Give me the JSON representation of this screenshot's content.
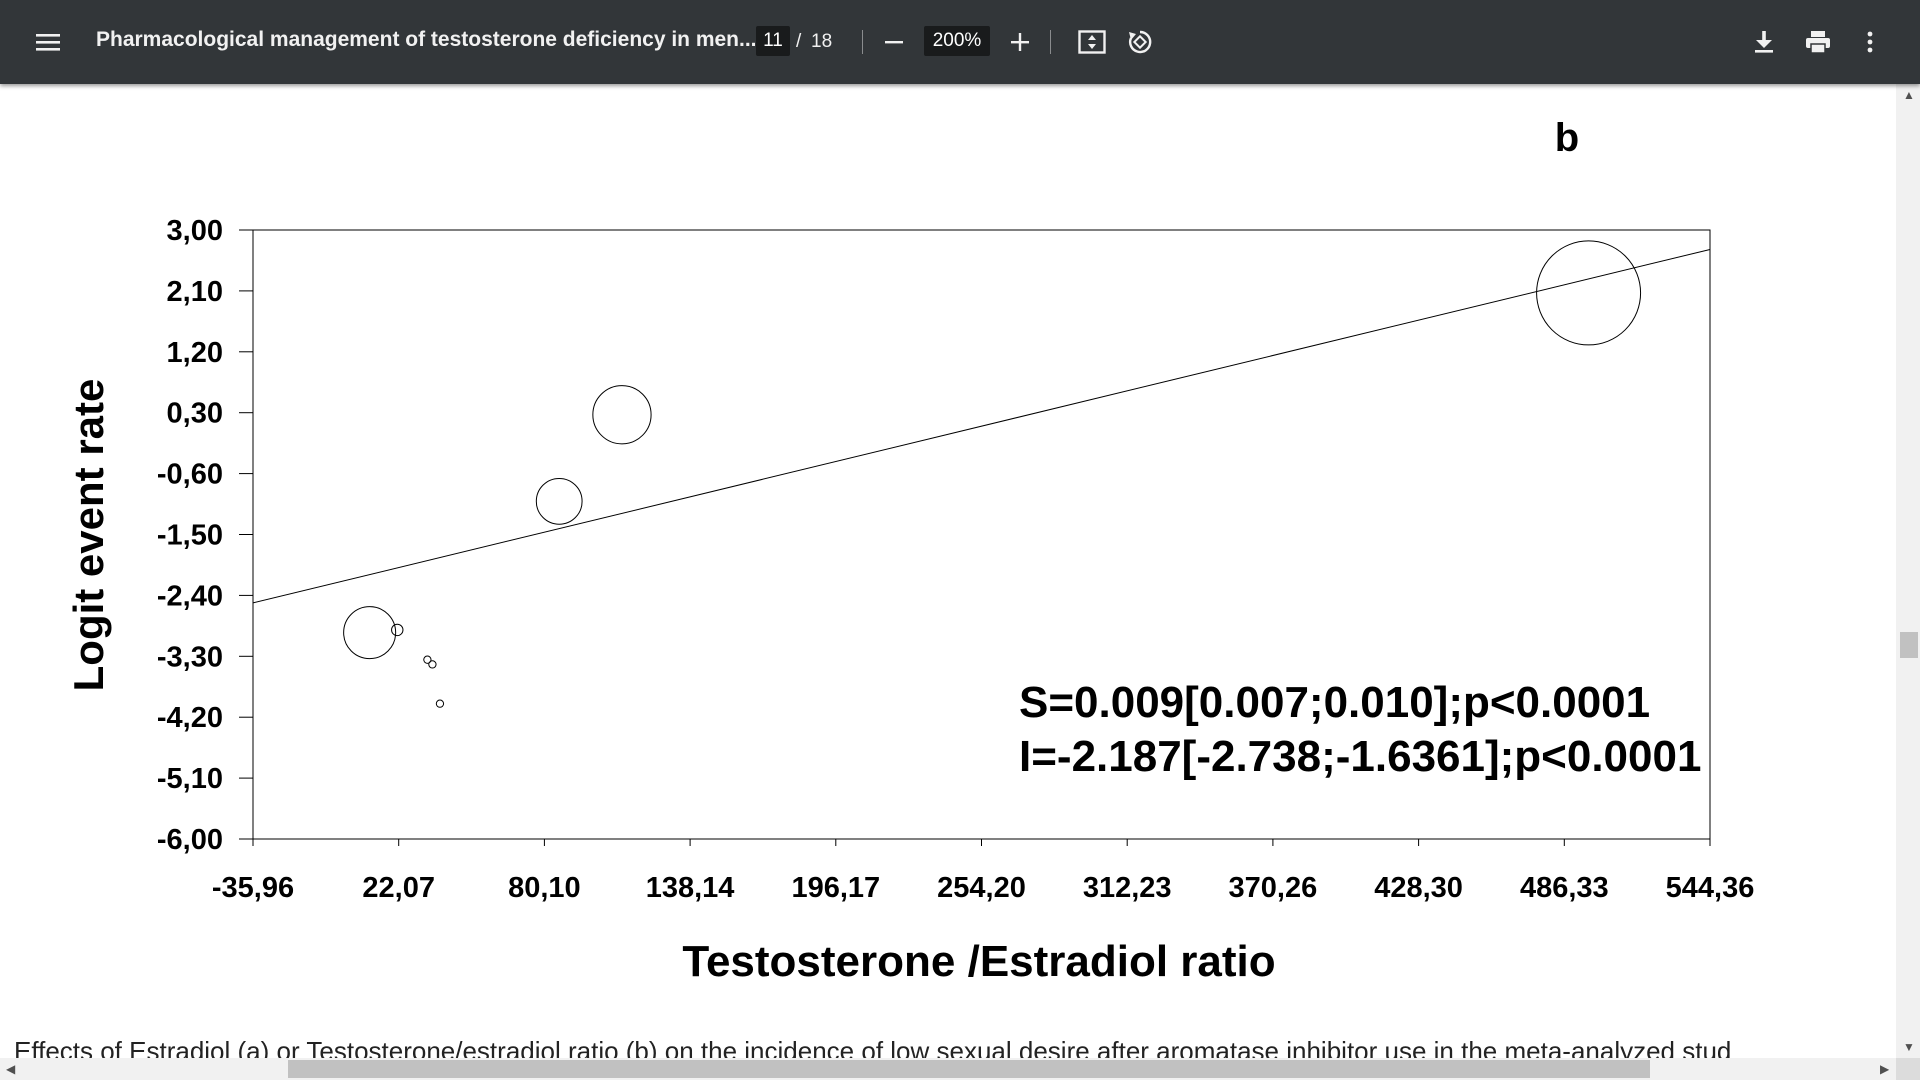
{
  "toolbar": {
    "title": "Pharmacological management of testosterone deficiency in men...",
    "page_current": "11",
    "page_separator": "/",
    "page_total": "18",
    "zoom": "200%",
    "icons": [
      "menu-icon",
      "zoom-out-icon",
      "zoom-in-icon",
      "fit-page-icon",
      "rotate-icon",
      "download-icon",
      "print-icon",
      "more-vert-icon"
    ]
  },
  "figure": {
    "panel_label": "b",
    "annotation_line1": "S=0.009[0.007;0.010];p<0.0001",
    "annotation_line2": "I=-2.187[-2.738;-1.6361];p<0.0001"
  },
  "chart_data": {
    "type": "scatter",
    "xlabel": "Testosterone /Estradiol ratio",
    "ylabel": "Logit event rate",
    "xlim": [
      -35.96,
      544.36
    ],
    "ylim": [
      -6.0,
      3.0
    ],
    "x_ticks": [
      "-35,96",
      "22,07",
      "80,10",
      "138,14",
      "196,17",
      "254,20",
      "312,23",
      "370,26",
      "428,30",
      "486,33",
      "544,36"
    ],
    "y_ticks": [
      "3,00",
      "2,10",
      "1,20",
      "0,30",
      "-0,60",
      "-1,50",
      "-2,40",
      "-3,30",
      "-4,20",
      "-5,10",
      "-6,00"
    ],
    "points": [
      {
        "x": 10.5,
        "y": -2.95,
        "weight": 1.0
      },
      {
        "x": 21.5,
        "y": -2.91,
        "weight": 0.22
      },
      {
        "x": 33.5,
        "y": -3.35,
        "weight": 0.14
      },
      {
        "x": 35.5,
        "y": -3.42,
        "weight": 0.14
      },
      {
        "x": 38.5,
        "y": -4.0,
        "weight": 0.14
      },
      {
        "x": 86.0,
        "y": -1.01,
        "weight": 0.88
      },
      {
        "x": 111.0,
        "y": 0.27,
        "weight": 1.12
      },
      {
        "x": 496.0,
        "y": 2.07,
        "weight": 2.0
      }
    ],
    "regression": {
      "slope": 0.009,
      "intercept": -2.187
    },
    "grid": false
  },
  "caption": "Effects of Estradiol (a) or Testosterone/estradiol ratio (b) on the incidence of low sexual desire after aromatase inhibitor use in the meta-analyzed stud"
}
